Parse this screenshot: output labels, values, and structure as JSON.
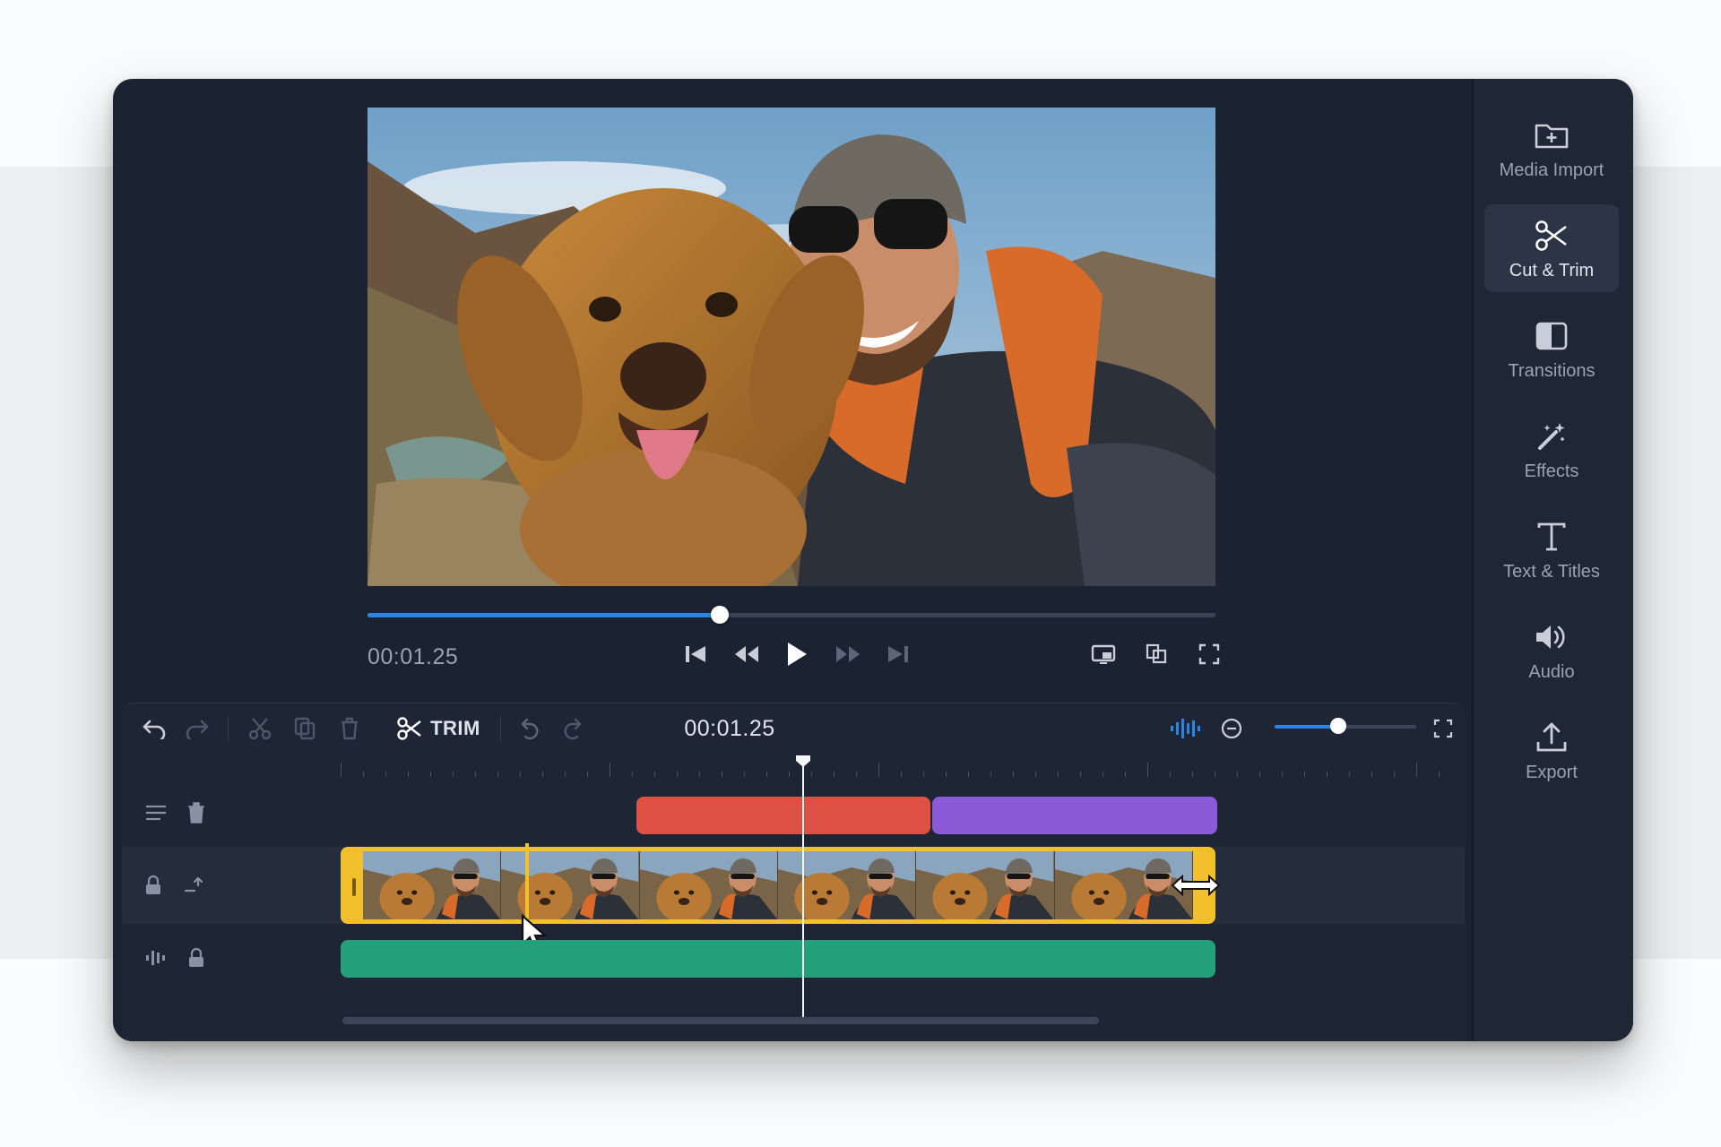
{
  "app": {
    "preview": {
      "current_time": "00:01.25",
      "progress": 0.415
    },
    "sidebar": {
      "items": [
        {
          "label": "Media Import",
          "icon": "folder-plus-icon"
        },
        {
          "label": "Cut & Trim",
          "icon": "scissors-icon",
          "active": true
        },
        {
          "label": "Transitions",
          "icon": "transition-icon"
        },
        {
          "label": "Effects",
          "icon": "magic-wand-icon"
        },
        {
          "label": "Text & Titles",
          "icon": "text-icon"
        },
        {
          "label": "Audio",
          "icon": "speaker-icon"
        },
        {
          "label": "Export",
          "icon": "upload-icon"
        }
      ]
    },
    "timeline": {
      "trim_label": "TRIM",
      "current_time": "00:01.25",
      "zoom": 0.45
    }
  },
  "colors": {
    "accent": "#2a86e2",
    "clip_red": "#de5043",
    "clip_purple": "#8a5ad8",
    "clip_green": "#22a077",
    "trim_handle": "#f2c02c",
    "panel": "#1b2231"
  }
}
